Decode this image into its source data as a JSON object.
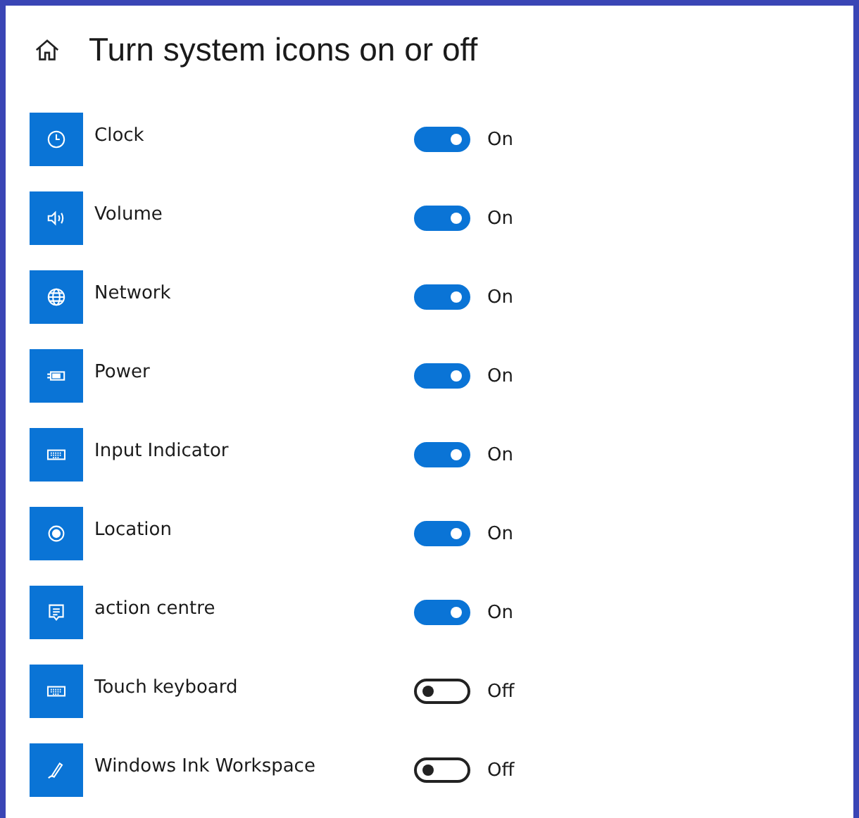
{
  "header": {
    "title": "Turn system icons on or off"
  },
  "items": [
    {
      "kind": "clock",
      "label": "Clock",
      "on": true,
      "state": "On"
    },
    {
      "kind": "volume",
      "label": "Volume",
      "on": true,
      "state": "On"
    },
    {
      "kind": "network",
      "label": "Network",
      "on": true,
      "state": "On"
    },
    {
      "kind": "power",
      "label": "Power",
      "on": true,
      "state": "On"
    },
    {
      "kind": "keyboard",
      "label": "Input Indicator",
      "on": true,
      "state": "On"
    },
    {
      "kind": "location",
      "label": "Location",
      "on": true,
      "state": "On"
    },
    {
      "kind": "message",
      "label": "action centre",
      "on": true,
      "state": "On"
    },
    {
      "kind": "keyboard",
      "label": "Touch keyboard",
      "on": false,
      "state": "Off"
    },
    {
      "kind": "pen",
      "label": "Windows Ink Workspace",
      "on": false,
      "state": "Off"
    }
  ]
}
